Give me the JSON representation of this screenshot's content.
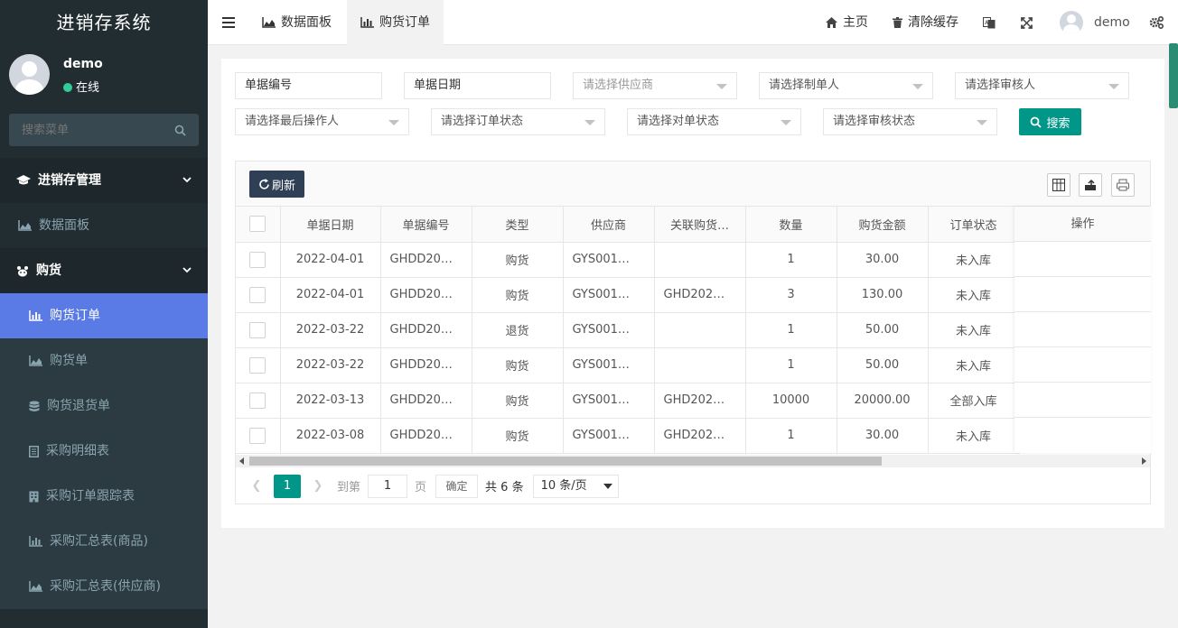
{
  "app": {
    "title": "进销存系统"
  },
  "user": {
    "name": "demo",
    "status": "在线"
  },
  "sidebar": {
    "search_placeholder": "搜索菜单",
    "items": [
      {
        "label": "进销存管理",
        "icon": "graduation-cap-icon"
      },
      {
        "label": "数据面板",
        "icon": "area-chart-icon"
      },
      {
        "label": "购货",
        "icon": "paw-icon"
      },
      {
        "label": "购货订单",
        "icon": "bar-chart-icon"
      },
      {
        "label": "购货单",
        "icon": "area-chart-icon"
      },
      {
        "label": "购货退货单",
        "icon": "database-icon"
      },
      {
        "label": "采购明细表",
        "icon": "document-icon"
      },
      {
        "label": "采购订单跟踪表",
        "icon": "building-icon"
      },
      {
        "label": "采购汇总表(商品)",
        "icon": "bar-chart-icon"
      },
      {
        "label": "采购汇总表(供应商)",
        "icon": "area-chart-icon"
      }
    ]
  },
  "topbar": {
    "tabs": [
      {
        "label": "数据面板"
      },
      {
        "label": "购货订单"
      }
    ],
    "home": "主页",
    "clear_cache": "清除缓存",
    "user": "demo"
  },
  "filters": {
    "doc_no": "单据编号",
    "doc_date": "单据日期",
    "supplier": "请选择供应商",
    "maker": "请选择制单人",
    "reviewer": "请选择审核人",
    "last_operator": "请选择最后操作人",
    "order_status": "请选择订单状态",
    "reconcile_status": "请选择对单状态",
    "review_status": "请选择审核状态",
    "search_button": "搜索"
  },
  "table": {
    "refresh": "刷新",
    "columns": [
      "单据日期",
      "单据编号",
      "类型",
      "供应商",
      "关联购货…",
      "数量",
      "购货金额",
      "订单状态",
      "操作"
    ],
    "rows": [
      {
        "date": "2022-04-01",
        "no": "GHDD20…",
        "type": "购货",
        "supplier": "GYS001…",
        "linked": "",
        "qty": "1",
        "amount": "30.00",
        "status": "未入库"
      },
      {
        "date": "2022-04-01",
        "no": "GHDD20…",
        "type": "购货",
        "supplier": "GYS001…",
        "linked": "GHD202…",
        "qty": "3",
        "amount": "130.00",
        "status": "未入库"
      },
      {
        "date": "2022-03-22",
        "no": "GHDD20…",
        "type": "退货",
        "supplier": "GYS001…",
        "linked": "",
        "qty": "1",
        "amount": "50.00",
        "status": "未入库"
      },
      {
        "date": "2022-03-22",
        "no": "GHDD20…",
        "type": "购货",
        "supplier": "GYS001…",
        "linked": "",
        "qty": "1",
        "amount": "50.00",
        "status": "未入库"
      },
      {
        "date": "2022-03-13",
        "no": "GHDD20…",
        "type": "购货",
        "supplier": "GYS001…",
        "linked": "GHD202…",
        "qty": "10000",
        "amount": "20000.00",
        "status": "全部入库"
      },
      {
        "date": "2022-03-08",
        "no": "GHDD20…",
        "type": "购货",
        "supplier": "GYS001…",
        "linked": "GHD202…",
        "qty": "1",
        "amount": "30.00",
        "status": "未入库"
      }
    ]
  },
  "pager": {
    "current": "1",
    "goto_label": "到第",
    "goto_value": "1",
    "page_label": "页",
    "confirm": "确定",
    "total": "共 6 条",
    "page_size": "10 条/页"
  },
  "colors": {
    "sidebar_bg": "#222d32",
    "active": "#5a7ae5",
    "primary": "#009688",
    "dark_button": "#2f4056"
  }
}
